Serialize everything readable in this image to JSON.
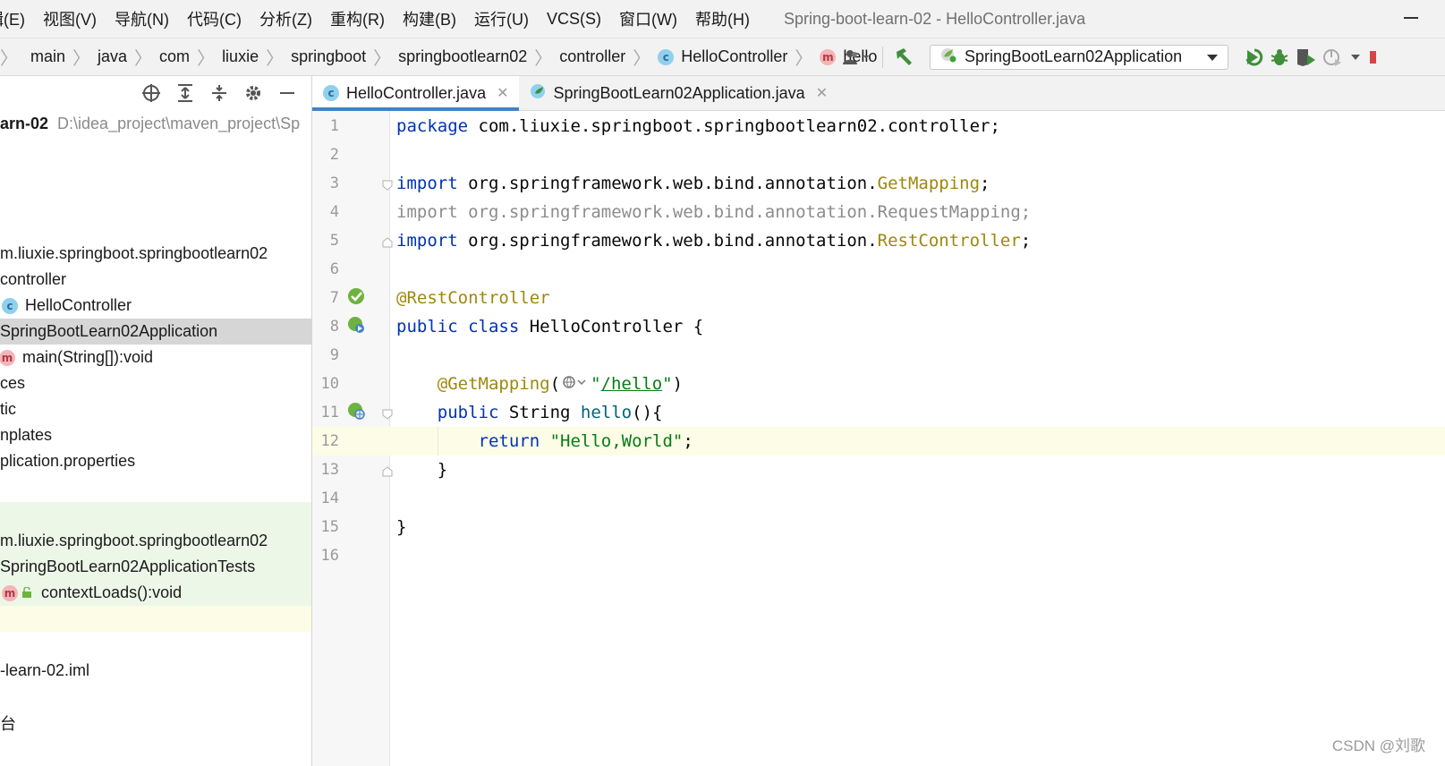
{
  "menu": {
    "items": [
      "辑(E)",
      "视图(V)",
      "导航(N)",
      "代码(C)",
      "分析(Z)",
      "重构(R)",
      "构建(B)",
      "运行(U)",
      "VCS(S)",
      "窗口(W)",
      "帮助(H)"
    ],
    "window_title": "Spring-boot-learn-02 - HelloController.java"
  },
  "breadcrumb": {
    "items": [
      "main",
      "java",
      "com",
      "liuxie",
      "springboot",
      "springbootlearn02",
      "controller",
      "HelloController",
      "hello"
    ]
  },
  "toolbar": {
    "icons": [
      "user-icon",
      "build-hammer-icon",
      "rerun-icon",
      "debug-bug-icon",
      "coverage-icon",
      "profile-icon",
      "stop-icon"
    ],
    "run_config_label": "SpringBootLearn02Application"
  },
  "project_panel": {
    "toolbar_icons": [
      "locate-icon",
      "expand-all-icon",
      "collapse-all-icon",
      "settings-gear-icon",
      "hide-icon"
    ],
    "root_name": "arn-02",
    "root_path": "D:\\idea_project\\maven_project\\Sp",
    "rows": [
      "m.liuxie.springboot.springbootlearn02",
      "controller",
      "HelloController",
      "SpringBootLearn02Application",
      "main(String[]):void",
      "ces",
      "tic",
      "nplates",
      "plication.properties",
      "m.liuxie.springboot.springbootlearn02",
      "SpringBootLearn02ApplicationTests",
      "contextLoads():void",
      "-learn-02.iml",
      "台"
    ]
  },
  "tabs": [
    {
      "label": "HelloController.java",
      "active": true
    },
    {
      "label": "SpringBootLearn02Application.java",
      "active": false
    }
  ],
  "code": {
    "line_numbers": [
      "1",
      "2",
      "3",
      "4",
      "5",
      "6",
      "7",
      "8",
      "9",
      "10",
      "11",
      "12",
      "13",
      "14",
      "15",
      "16"
    ],
    "l1_kw": "package",
    "l1_rest": " com.liuxie.springboot.springbootlearn02.controller;",
    "l3_kw": "import",
    "l3_pkg": " org.springframework.web.bind.annotation.",
    "l3_cls": "GetMapping",
    "l3_end": ";",
    "l4_text": "import org.springframework.web.bind.annotation.RequestMapping;",
    "l5_kw": "import",
    "l5_pkg": " org.springframework.web.bind.annotation.",
    "l5_cls": "RestController",
    "l5_end": ";",
    "l7_ann": "@RestController",
    "l8_kw1": "public",
    "l8_kw2": "class",
    "l8_rest": " HelloController {",
    "l10_ann": "@GetMapping",
    "l10_open": "(",
    "l10_q1": "\"",
    "l10_url": "/hello",
    "l10_q2": "\"",
    "l10_close": ")",
    "l11_kw": "public",
    "l11_type": " String ",
    "l11_method": "hello",
    "l11_rest": "(){",
    "l12_kw": "return",
    "l12_str": "\"Hello,World\"",
    "l12_end": ";",
    "l13": "}",
    "l15": "}"
  },
  "watermark": "CSDN @刘歌",
  "colors": {
    "keyword": "#0033b3",
    "annotation": "#9e880d",
    "string": "#067d17",
    "method": "#00627a",
    "selection": "#d6d6d6",
    "test_background": "#edf7e8",
    "active_tab_underline": "#4083c9"
  }
}
